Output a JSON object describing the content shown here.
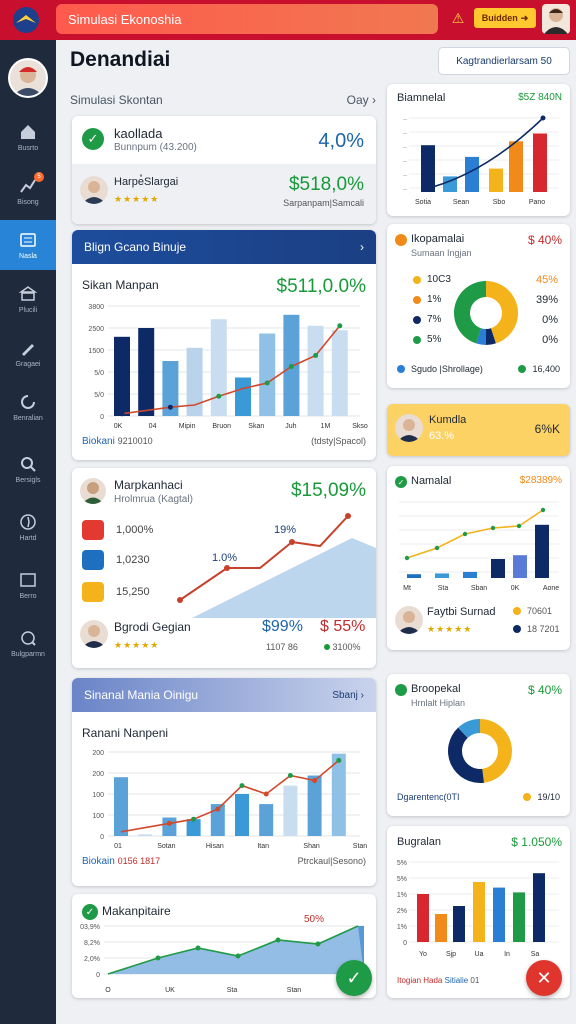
{
  "topbar": {
    "title": "Simulasi Ekonoshia",
    "button": "Buidden"
  },
  "sidebar": {
    "items": [
      {
        "label": "Busrto",
        "icon": "home-icon"
      },
      {
        "label": "Bisong",
        "icon": "chart-icon",
        "badge": "5"
      },
      {
        "label": "Nasla",
        "icon": "list-icon"
      },
      {
        "label": "Plucili",
        "icon": "bank-icon"
      },
      {
        "label": "Gragaei",
        "icon": "pen-icon"
      },
      {
        "label": "Benralian",
        "icon": "refresh-icon"
      },
      {
        "label": "Bersigls",
        "icon": "search-icon"
      },
      {
        "label": "Hartd",
        "icon": "compass-icon"
      },
      {
        "label": "Berro",
        "icon": "window-icon"
      },
      {
        "label": "Bulgparmn",
        "icon": "search-alt-icon"
      }
    ]
  },
  "header": {
    "title": "Denandiai",
    "right_button": "Kagtrandierlarsam 50",
    "sub_left": "Simulasi Skontan",
    "sub_right": "Oay"
  },
  "card1": {
    "title": "kaollada",
    "subtitle": "Bunnpum (43.200)",
    "value": "4,0%"
  },
  "card2": {
    "title": "Harpe̊Slargai",
    "value": "$518,0%",
    "sub": "Sarpanpam|Samcali"
  },
  "panel1": {
    "header": "Blign Gcano Binuje",
    "title": "Sikan Manpan",
    "value": "$511,0.0%",
    "yticks": [
      "3800",
      "2500",
      "1500",
      "5/0",
      "5/0",
      "0"
    ],
    "xlabels": [
      "0K",
      "04",
      "Mipin",
      "Bruon",
      "Skan",
      "Juh",
      "1M",
      "Skso"
    ],
    "footer_left": "Biokani",
    "footer_left2": "9210010",
    "footer_right": "(tdsty|Spacol)"
  },
  "panel2": {
    "title": "Marpkanhaci",
    "subtitle": "Hrolmrua (Kagtal)",
    "value": "$15,09%",
    "rows": [
      "1,000%",
      "1,0230",
      "15,250"
    ],
    "label_a": "1.0%",
    "label_b": "19%",
    "person": "Bgrodi Gegian",
    "p_value1": "$99%",
    "p_value2": "$ 55%",
    "p_sub1": "1107 86",
    "p_sub2": "3100%"
  },
  "panel3": {
    "header": "Sinanal Mania Oinigu",
    "header_right": "Sbanj",
    "title": "Ranani Nanpeni",
    "yticks": [
      "200",
      "200",
      "100",
      "100",
      "0"
    ],
    "xlabels": [
      "01",
      "Sotan",
      "Hisan",
      "Itan",
      "Shan",
      "Stan"
    ],
    "footer_left": "Biokain",
    "footer_left2": "0156 1817",
    "footer_right": "Ptrckaul|Sesono)"
  },
  "panel4": {
    "title": "Makanpitaire",
    "label": "50%",
    "yticks": [
      "03,9%",
      "8,2%",
      "2,0%",
      "0"
    ],
    "xlabels": [
      "O",
      "UK",
      "Sta",
      "Stan",
      "Sban"
    ]
  },
  "right1": {
    "title": "Biamnelal",
    "value": "$5Z 840N",
    "xlabels": [
      "Sotia",
      "Sean",
      "Sbo",
      "Pano"
    ]
  },
  "right2": {
    "title": "Ikopamalai",
    "value": "$ 40%",
    "subtitle": "Sumaan Ingjan",
    "legend": [
      "10C3",
      "1%",
      "7%",
      "5%"
    ],
    "pcts": [
      "45%",
      "39%",
      "0%",
      "0%"
    ],
    "footer_left": "Sgudo |Shrollage)",
    "footer_right": "16,400"
  },
  "right3": {
    "title": "Kumdla",
    "value": "63.%",
    "right": "6%K"
  },
  "right4": {
    "title": "Namalal",
    "value": "$28389%",
    "xlabels": [
      "Mt",
      "Sta",
      "Sban",
      "0K",
      "Aone"
    ],
    "person": "Faytbi Surnad",
    "v1": "70601",
    "v2": "18 7201"
  },
  "right5": {
    "title": "Broopekal",
    "value": "$ 40%",
    "subtitle": "Hrnlalt Hiplan",
    "footer_left": "Dgarentenc(0TI",
    "footer_right": "19/10"
  },
  "right6": {
    "title": "Bugralan",
    "value": "$ 1.050%",
    "yticks": [
      "5%",
      "5%",
      "1%",
      "2%",
      "1%",
      "0"
    ],
    "xlabels": [
      "Yo",
      "Sjp",
      "Ua",
      "In",
      "Sa"
    ],
    "footer_left": "Itogian Hada",
    "footer_mid": "Sitialie",
    "footer_right": "01"
  },
  "colors": {
    "navy": "#0d2a66",
    "blue": "#2a7fd4",
    "green": "#199a3a",
    "red": "#d6282e",
    "orange": "#f28a1a",
    "yellow": "#f4b21b"
  }
}
